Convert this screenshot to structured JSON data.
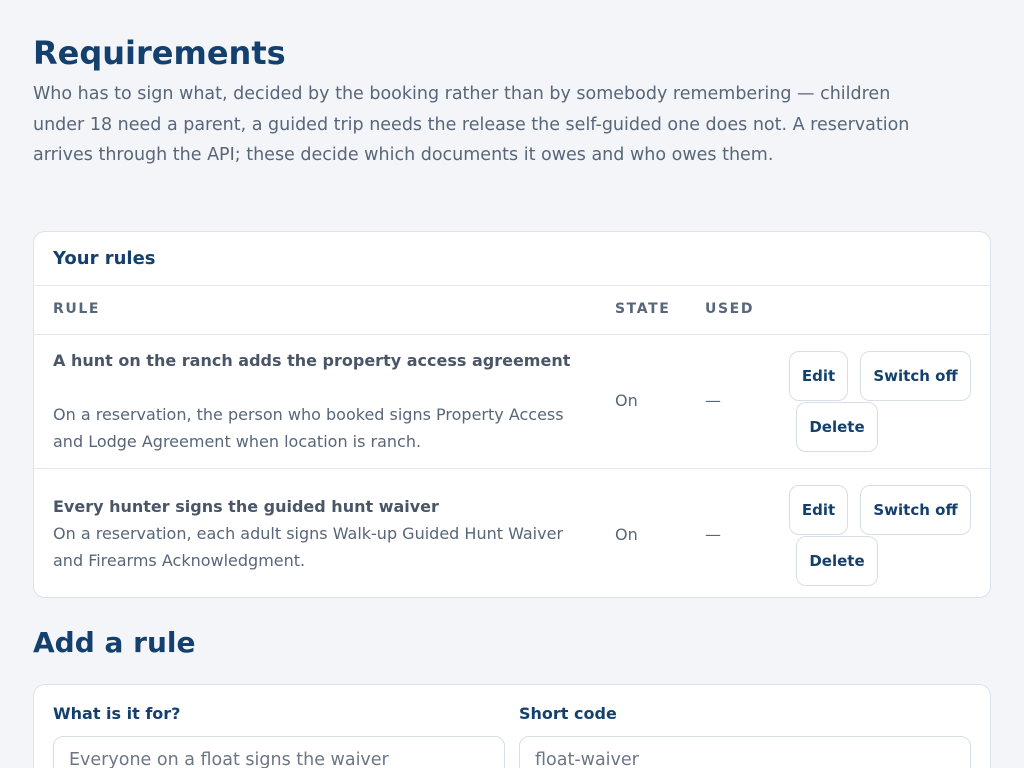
{
  "header": {
    "title": "Requirements",
    "intro": "Who has to sign what, decided by the booking rather than by somebody remembering — children under 18 need a parent, a guided trip needs the release the self-guided one does not. A reservation arrives through the API; these decide which documents it owes and who owes them."
  },
  "rules_table": {
    "title": "Your rules",
    "columns": {
      "rule": "RULE",
      "state": "STATE",
      "used": "USED"
    },
    "rows": [
      {
        "name": "A hunt on the ranch adds the property access agreement",
        "description": "On a reservation, the person who booked signs Property Access and Lodge Agreement when location is ranch.",
        "state": "On",
        "used": "—",
        "actions": {
          "edit": "Edit",
          "switch": "Switch off",
          "delete": "Delete"
        }
      },
      {
        "name": "Every hunter signs the guided hunt waiver",
        "description": "On a reservation, each adult signs Walk-up Guided Hunt Waiver and Firearms Acknowledgment.",
        "state": "On",
        "used": "—",
        "actions": {
          "edit": "Edit",
          "switch": "Switch off",
          "delete": "Delete"
        }
      }
    ]
  },
  "add_rule": {
    "title": "Add a rule",
    "purpose_label": "What is it for?",
    "purpose_placeholder": "Everyone on a float signs the waiver",
    "code_label": "Short code",
    "code_placeholder": "float-waiver"
  }
}
